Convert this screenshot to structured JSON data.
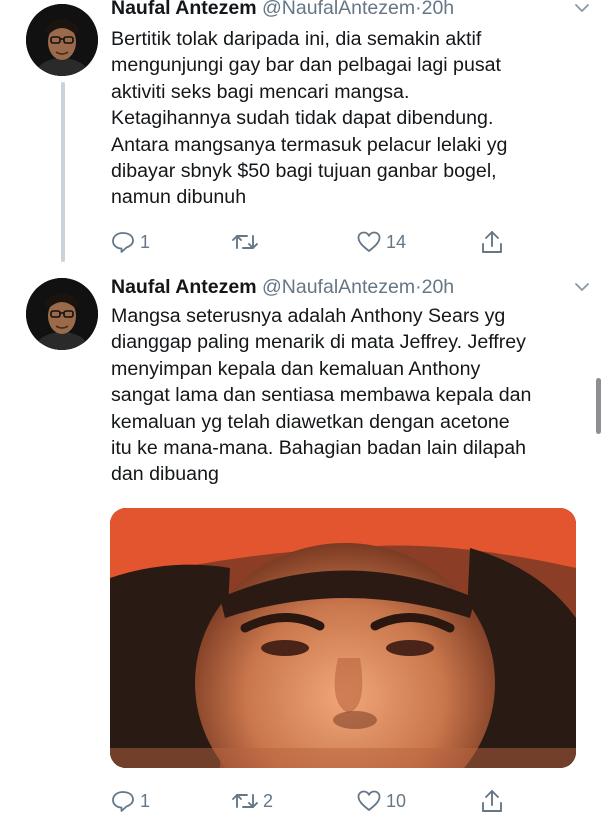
{
  "tweets": [
    {
      "author": {
        "display_name": "Naufal Antezem",
        "handle": "@NaufalAntezem",
        "separator": "·",
        "time": "20h"
      },
      "text": "Bertitik tolak daripada ini, dia semakin aktif\nmengunjungi gay bar dan pelbagai lagi pusat\naktiviti seks bagi mencari mangsa.\nKetagihannya sudah tidak dapat dibendung.\nAntara mangsanya termasuk pelacur lelaki yg\ndibayar sbnyk $50 bagi tujuan ganbar bogel,\nnamun dibunuh",
      "actions": {
        "reply_count": "1",
        "retweet_count": "",
        "like_count": "14"
      }
    },
    {
      "author": {
        "display_name": "Naufal Antezem",
        "handle": "@NaufalAntezem",
        "separator": "·",
        "time": "20h"
      },
      "text": "Mangsa seterusnya adalah Anthony Sears yg\ndianggap paling menarik di mata Jeffrey. Jeffrey\nmenyimpan kepala dan kemaluan Anthony\nsangat lama dan sentiasa membawa kepala dan\nkemaluan yg telah diawetkan dengan acetone\nitu ke mana-mana. Bahagian badan lain dilapah\ndan dibuang",
      "actions": {
        "reply_count": "1",
        "retweet_count": "2",
        "like_count": "10"
      }
    }
  ],
  "icons": {
    "reply": "reply-icon",
    "retweet": "retweet-icon",
    "like": "heart-icon",
    "share": "share-icon",
    "more": "chevron-down-icon"
  },
  "colors": {
    "text": "#14171a",
    "secondary": "#657786",
    "thread_line": "#c9d3dc",
    "background": "#ffffff"
  }
}
